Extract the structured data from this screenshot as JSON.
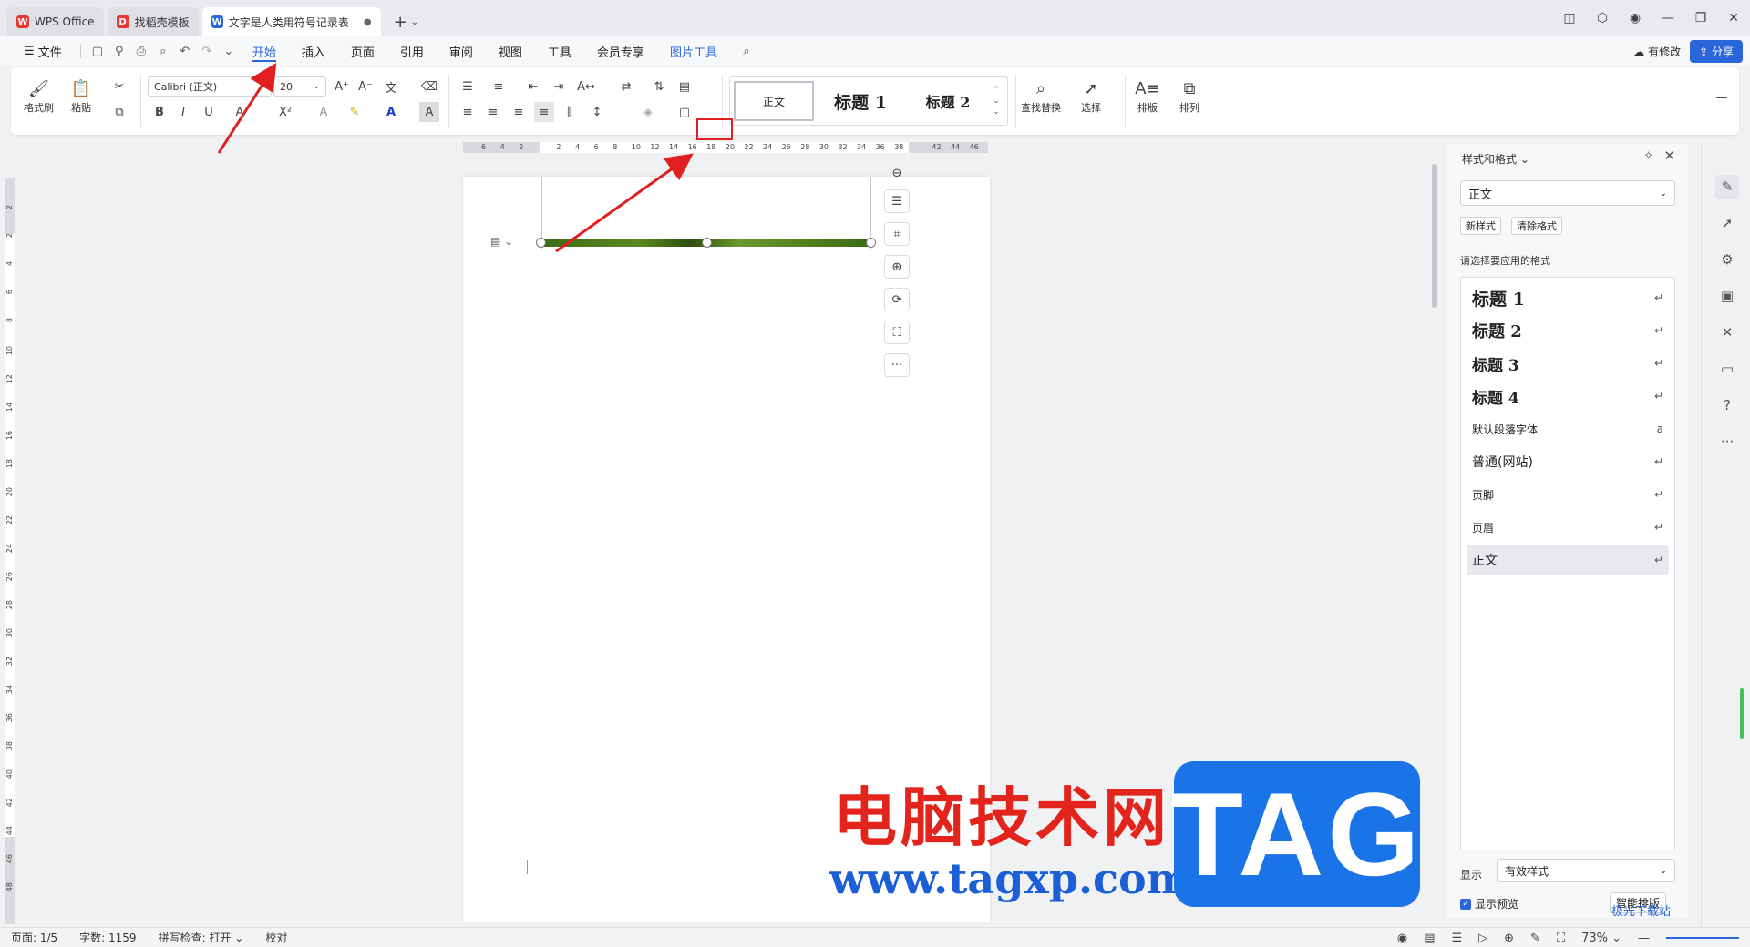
{
  "tabs": [
    {
      "label": "WPS Office",
      "logo": "W",
      "color": "#e53935"
    },
    {
      "label": "找稻壳模板",
      "logo": "D",
      "color": "#e53935"
    },
    {
      "label": "文字是人类用符号记录表达信息以",
      "logo": "W",
      "color": "#2a66d9"
    }
  ],
  "menu": {
    "file": "文件",
    "items": [
      "开始",
      "插入",
      "页面",
      "引用",
      "审阅",
      "视图",
      "工具",
      "会员专享",
      "图片工具"
    ],
    "modified": "有修改",
    "share": "分享"
  },
  "ribbon": {
    "format_painter": "格式刷",
    "paste": "粘贴",
    "font_name": "Calibri (正文)",
    "font_size": "20",
    "style_normal": "正文",
    "style_h1": "标题 1",
    "style_h2": "标题 2",
    "find_replace": "查找替换",
    "select": "选择",
    "layout": "排版",
    "arrange": "排列"
  },
  "ruler_ticks": [
    "6",
    "4",
    "2",
    "",
    "2",
    "4",
    "6",
    "8",
    "10",
    "12",
    "14",
    "16",
    "18",
    "20",
    "22",
    "24",
    "26",
    "28",
    "30",
    "32",
    "34",
    "36",
    "38",
    "",
    "42",
    "44",
    "46"
  ],
  "vruler_ticks": [
    "2",
    "2",
    "4",
    "6",
    "8",
    "10",
    "12",
    "14",
    "16",
    "18",
    "20",
    "22",
    "24",
    "26",
    "28",
    "30",
    "32",
    "34",
    "36",
    "38",
    "40",
    "42",
    "44",
    "46",
    "48"
  ],
  "panel": {
    "title": "样式和格式",
    "current_style": "正文",
    "new_style": "新样式",
    "clear_format": "清除格式",
    "hint": "请选择要应用的格式",
    "styles": [
      "标题 1",
      "标题 2",
      "标题 3",
      "标题 4",
      "默认段落字体",
      "普通(网站)",
      "页脚",
      "页眉",
      "正文"
    ],
    "display_label": "显示",
    "display_value": "有效样式",
    "show_preview": "显示预览",
    "smart_layout": "智能排版"
  },
  "status": {
    "page": "页面: 1/5",
    "words": "字数: 1159",
    "spellcheck": "拼写检查: 打开",
    "proofread": "校对",
    "zoom": "73%"
  },
  "watermark": {
    "cn": "电脑技术网",
    "url": "www.tagxp.com",
    "tag": "TAG",
    "site": "极光下载站"
  }
}
